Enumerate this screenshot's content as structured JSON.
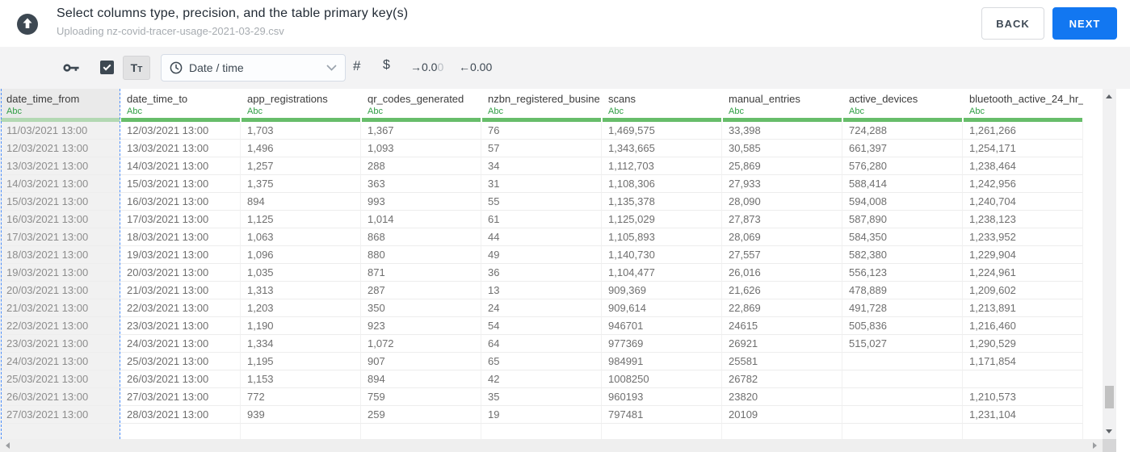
{
  "header": {
    "title": "Select columns type, precision, and the table primary key(s)",
    "subtitle": "Uploading nz-covid-tracer-usage-2021-03-29.csv",
    "back_label": "BACK",
    "next_label": "NEXT"
  },
  "toolbar": {
    "checkbox_checked": true,
    "text_type_label": "Tt",
    "type_dropdown": {
      "value": "Date / time"
    },
    "number_label": "#",
    "currency_label": "$",
    "increase_precision": {
      "dark": "→0.0",
      "light": "0"
    },
    "decrease_precision": {
      "dark": "←0.00",
      "light": ""
    }
  },
  "colors": {
    "accent_blue": "#1277f1",
    "selection_blue": "#4c8ffb",
    "type_green": "#2f9e44",
    "bar_green": "#67bd6a",
    "bar_green_selected": "#b3d8b3"
  },
  "table": {
    "columns": [
      {
        "name": "date_time_from",
        "type": "Abc",
        "selected": true
      },
      {
        "name": "date_time_to",
        "type": "Abc"
      },
      {
        "name": "app_registrations",
        "type": "Abc"
      },
      {
        "name": "qr_codes_generated",
        "type": "Abc"
      },
      {
        "name": "nzbn_registered_busine",
        "type": "Abc"
      },
      {
        "name": "scans",
        "type": "Abc"
      },
      {
        "name": "manual_entries",
        "type": "Abc"
      },
      {
        "name": "active_devices",
        "type": "Abc"
      },
      {
        "name": "bluetooth_active_24_hr_",
        "type": "Abc"
      }
    ],
    "rows": [
      [
        "11/03/2021 13:00",
        "12/03/2021 13:00",
        "1,703",
        "1,367",
        "76",
        "1,469,575",
        "33,398",
        "724,288",
        "1,261,266"
      ],
      [
        "12/03/2021 13:00",
        "13/03/2021 13:00",
        "1,496",
        "1,093",
        "57",
        "1,343,665",
        "30,585",
        "661,397",
        "1,254,171"
      ],
      [
        "13/03/2021 13:00",
        "14/03/2021 13:00",
        "1,257",
        "288",
        "34",
        "1,112,703",
        "25,869",
        "576,280",
        "1,238,464"
      ],
      [
        "14/03/2021 13:00",
        "15/03/2021 13:00",
        "1,375",
        "363",
        "31",
        "1,108,306",
        "27,933",
        "588,414",
        "1,242,956"
      ],
      [
        "15/03/2021 13:00",
        "16/03/2021 13:00",
        "894",
        "993",
        "55",
        "1,135,378",
        "28,090",
        "594,008",
        "1,240,704"
      ],
      [
        "16/03/2021 13:00",
        "17/03/2021 13:00",
        "1,125",
        "1,014",
        "61",
        "1,125,029",
        "27,873",
        "587,890",
        "1,238,123"
      ],
      [
        "17/03/2021 13:00",
        "18/03/2021 13:00",
        "1,063",
        "868",
        "44",
        "1,105,893",
        "28,069",
        "584,350",
        "1,233,952"
      ],
      [
        "18/03/2021 13:00",
        "19/03/2021 13:00",
        "1,096",
        "880",
        "49",
        "1,140,730",
        "27,557",
        "582,380",
        "1,229,904"
      ],
      [
        "19/03/2021 13:00",
        "20/03/2021 13:00",
        "1,035",
        "871",
        "36",
        "1,104,477",
        "26,016",
        "556,123",
        "1,224,961"
      ],
      [
        "20/03/2021 13:00",
        "21/03/2021 13:00",
        "1,313",
        "287",
        "13",
        "909,369",
        "21,626",
        "478,889",
        "1,209,602"
      ],
      [
        "21/03/2021 13:00",
        "22/03/2021 13:00",
        "1,203",
        "350",
        "24",
        "909,614",
        "22,869",
        "491,728",
        "1,213,891"
      ],
      [
        "22/03/2021 13:00",
        "23/03/2021 13:00",
        "1,190",
        "923",
        "54",
        "946701",
        "24615",
        "505,836",
        "1,216,460"
      ],
      [
        "23/03/2021 13:00",
        "24/03/2021 13:00",
        "1,334",
        "1,072",
        "64",
        "977369",
        "26921",
        "515,027",
        "1,290,529"
      ],
      [
        "24/03/2021 13:00",
        "25/03/2021 13:00",
        "1,195",
        "907",
        "65",
        "984991",
        "25581",
        "",
        "1,171,854"
      ],
      [
        "25/03/2021 13:00",
        "26/03/2021 13:00",
        "1,153",
        "894",
        "42",
        "1008250",
        "26782",
        "",
        ""
      ],
      [
        "26/03/2021 13:00",
        "27/03/2021 13:00",
        "772",
        "759",
        "35",
        "960193",
        "23820",
        "",
        "1,210,573"
      ],
      [
        "27/03/2021 13:00",
        "28/03/2021 13:00",
        "939",
        "259",
        "19",
        "797481",
        "20109",
        "",
        "1,231,104"
      ]
    ]
  }
}
